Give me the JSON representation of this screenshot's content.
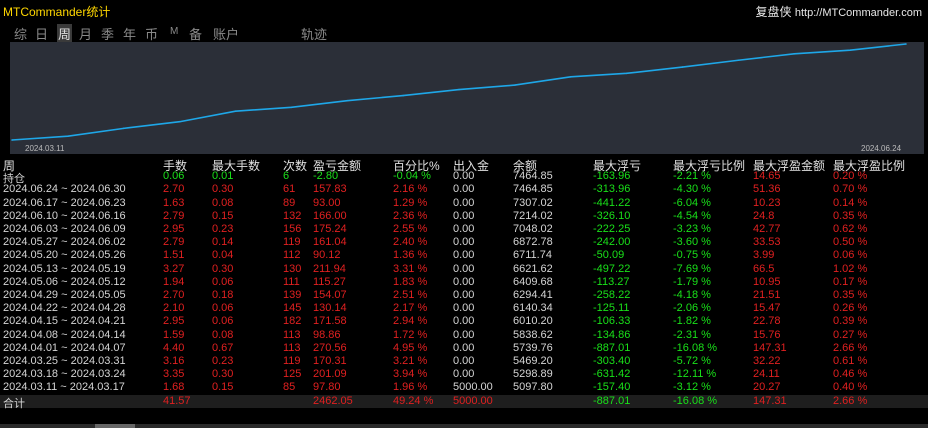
{
  "title": "MTCommander统计",
  "brand": {
    "name": "复盘侠",
    "url": "http://MTCommander.com"
  },
  "tabs": [
    "综",
    "日",
    "周",
    "月",
    "季",
    "年",
    "币",
    "M",
    "备",
    "账户",
    "轨迹"
  ],
  "active_tab": "周",
  "chart_data": {
    "type": "line",
    "x_start_label": "2024.03.11",
    "x_end_label": "2024.06.24",
    "x": [
      "2024.03.11",
      "2024.03.18",
      "2024.03.25",
      "2024.04.01",
      "2024.04.08",
      "2024.04.15",
      "2024.04.22",
      "2024.04.29",
      "2024.05.06",
      "2024.05.13",
      "2024.05.20",
      "2024.05.27",
      "2024.06.03",
      "2024.06.10",
      "2024.06.17",
      "2024.06.24"
    ],
    "values": [
      5000.0,
      5097.8,
      5298.89,
      5469.2,
      5739.76,
      5838.62,
      6010.2,
      6140.34,
      6294.41,
      6409.68,
      6621.62,
      6711.74,
      6872.78,
      7048.02,
      7214.02,
      7307.02,
      7464.85
    ],
    "color": "#1ea7e8"
  },
  "columns": [
    "周",
    "手数",
    "最大手数",
    "次数",
    "盈亏金额",
    "百分比%",
    "出入金",
    "余额",
    "最大浮亏",
    "最大浮亏比例",
    "最大浮盈金额",
    "最大浮盈比例"
  ],
  "holding": {
    "label": "持仓",
    "lots": "0.06",
    "max_lots": "0.01",
    "count": "6",
    "pnl": "-2.80",
    "pct": "-0.04 %",
    "io": "0.00",
    "balance": "7464.85",
    "max_dd": "-163.96",
    "max_dd_pct": "-2.21 %",
    "max_fp": "14.65",
    "max_fp_pct": "0.20 %"
  },
  "rows": [
    {
      "week": "2024.06.24 ~ 2024.06.30",
      "lots": "2.70",
      "max_lots": "0.30",
      "count": "61",
      "pnl": "157.83",
      "pct": "2.16 %",
      "io": "0.00",
      "balance": "7464.85",
      "max_dd": "-313.96",
      "max_dd_pct": "-4.30 %",
      "max_fp": "51.36",
      "max_fp_pct": "0.70 %"
    },
    {
      "week": "2024.06.17 ~ 2024.06.23",
      "lots": "1.63",
      "max_lots": "0.08",
      "count": "89",
      "pnl": "93.00",
      "pct": "1.29 %",
      "io": "0.00",
      "balance": "7307.02",
      "max_dd": "-441.22",
      "max_dd_pct": "-6.04 %",
      "max_fp": "10.23",
      "max_fp_pct": "0.14 %"
    },
    {
      "week": "2024.06.10 ~ 2024.06.16",
      "lots": "2.79",
      "max_lots": "0.15",
      "count": "132",
      "pnl": "166.00",
      "pct": "2.36 %",
      "io": "0.00",
      "balance": "7214.02",
      "max_dd": "-326.10",
      "max_dd_pct": "-4.54 %",
      "max_fp": "24.8",
      "max_fp_pct": "0.35 %"
    },
    {
      "week": "2024.06.03 ~ 2024.06.09",
      "lots": "2.95",
      "max_lots": "0.23",
      "count": "156",
      "pnl": "175.24",
      "pct": "2.55 %",
      "io": "0.00",
      "balance": "7048.02",
      "max_dd": "-222.25",
      "max_dd_pct": "-3.23 %",
      "max_fp": "42.77",
      "max_fp_pct": "0.62 %"
    },
    {
      "week": "2024.05.27 ~ 2024.06.02",
      "lots": "2.79",
      "max_lots": "0.14",
      "count": "119",
      "pnl": "161.04",
      "pct": "2.40 %",
      "io": "0.00",
      "balance": "6872.78",
      "max_dd": "-242.00",
      "max_dd_pct": "-3.60 %",
      "max_fp": "33.53",
      "max_fp_pct": "0.50 %"
    },
    {
      "week": "2024.05.20 ~ 2024.05.26",
      "lots": "1.51",
      "max_lots": "0.04",
      "count": "112",
      "pnl": "90.12",
      "pct": "1.36 %",
      "io": "0.00",
      "balance": "6711.74",
      "max_dd": "-50.09",
      "max_dd_pct": "-0.75 %",
      "max_fp": "3.99",
      "max_fp_pct": "0.06 %"
    },
    {
      "week": "2024.05.13 ~ 2024.05.19",
      "lots": "3.27",
      "max_lots": "0.30",
      "count": "130",
      "pnl": "211.94",
      "pct": "3.31 %",
      "io": "0.00",
      "balance": "6621.62",
      "max_dd": "-497.22",
      "max_dd_pct": "-7.69 %",
      "max_fp": "66.5",
      "max_fp_pct": "1.02 %"
    },
    {
      "week": "2024.05.06 ~ 2024.05.12",
      "lots": "1.94",
      "max_lots": "0.06",
      "count": "111",
      "pnl": "115.27",
      "pct": "1.83 %",
      "io": "0.00",
      "balance": "6409.68",
      "max_dd": "-113.27",
      "max_dd_pct": "-1.79 %",
      "max_fp": "10.95",
      "max_fp_pct": "0.17 %"
    },
    {
      "week": "2024.04.29 ~ 2024.05.05",
      "lots": "2.70",
      "max_lots": "0.18",
      "count": "139",
      "pnl": "154.07",
      "pct": "2.51 %",
      "io": "0.00",
      "balance": "6294.41",
      "max_dd": "-258.22",
      "max_dd_pct": "-4.18 %",
      "max_fp": "21.51",
      "max_fp_pct": "0.35 %"
    },
    {
      "week": "2024.04.22 ~ 2024.04.28",
      "lots": "2.10",
      "max_lots": "0.06",
      "count": "145",
      "pnl": "130.14",
      "pct": "2.17 %",
      "io": "0.00",
      "balance": "6140.34",
      "max_dd": "-125.11",
      "max_dd_pct": "-2.06 %",
      "max_fp": "15.47",
      "max_fp_pct": "0.26 %"
    },
    {
      "week": "2024.04.15 ~ 2024.04.21",
      "lots": "2.95",
      "max_lots": "0.06",
      "count": "182",
      "pnl": "171.58",
      "pct": "2.94 %",
      "io": "0.00",
      "balance": "6010.20",
      "max_dd": "-106.33",
      "max_dd_pct": "-1.82 %",
      "max_fp": "22.78",
      "max_fp_pct": "0.39 %"
    },
    {
      "week": "2024.04.08 ~ 2024.04.14",
      "lots": "1.59",
      "max_lots": "0.08",
      "count": "113",
      "pnl": "98.86",
      "pct": "1.72 %",
      "io": "0.00",
      "balance": "5838.62",
      "max_dd": "-134.86",
      "max_dd_pct": "-2.31 %",
      "max_fp": "15.76",
      "max_fp_pct": "0.27 %"
    },
    {
      "week": "2024.04.01 ~ 2024.04.07",
      "lots": "4.40",
      "max_lots": "0.67",
      "count": "113",
      "pnl": "270.56",
      "pct": "4.95 %",
      "io": "0.00",
      "balance": "5739.76",
      "max_dd": "-887.01",
      "max_dd_pct": "-16.08 %",
      "max_fp": "147.31",
      "max_fp_pct": "2.66 %"
    },
    {
      "week": "2024.03.25 ~ 2024.03.31",
      "lots": "3.16",
      "max_lots": "0.23",
      "count": "119",
      "pnl": "170.31",
      "pct": "3.21 %",
      "io": "0.00",
      "balance": "5469.20",
      "max_dd": "-303.40",
      "max_dd_pct": "-5.72 %",
      "max_fp": "32.22",
      "max_fp_pct": "0.61 %"
    },
    {
      "week": "2024.03.18 ~ 2024.03.24",
      "lots": "3.35",
      "max_lots": "0.30",
      "count": "125",
      "pnl": "201.09",
      "pct": "3.94 %",
      "io": "0.00",
      "balance": "5298.89",
      "max_dd": "-631.42",
      "max_dd_pct": "-12.11 %",
      "max_fp": "24.11",
      "max_fp_pct": "0.46 %"
    },
    {
      "week": "2024.03.11 ~ 2024.03.17",
      "lots": "1.68",
      "max_lots": "0.15",
      "count": "85",
      "pnl": "97.80",
      "pct": "1.96 %",
      "io": "5000.00",
      "balance": "5097.80",
      "max_dd": "-157.40",
      "max_dd_pct": "-3.12 %",
      "max_fp": "20.27",
      "max_fp_pct": "0.40 %"
    }
  ],
  "total": {
    "label": "合计",
    "lots": "41.57",
    "pnl": "2462.05",
    "pct": "49.24 %",
    "io": "5000.00",
    "max_dd": "-887.01",
    "max_dd_pct": "-16.08 %",
    "max_fp": "147.31",
    "max_fp_pct": "2.66 %"
  }
}
